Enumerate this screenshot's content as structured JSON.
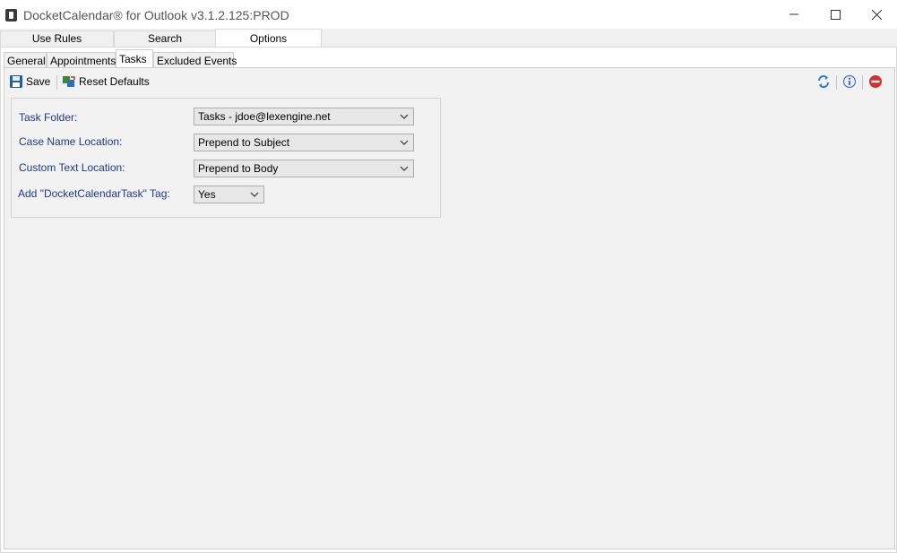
{
  "window": {
    "title": "DocketCalendar® for Outlook v3.1.2.125:PROD"
  },
  "main_tabs": [
    {
      "label": "Use Rules"
    },
    {
      "label": "Search"
    },
    {
      "label": "Options",
      "active": true
    }
  ],
  "sub_tabs": [
    {
      "label": "General"
    },
    {
      "label": "Appointments"
    },
    {
      "label": "Tasks",
      "active": true
    },
    {
      "label": "Excluded Events"
    }
  ],
  "toolbar": {
    "save_label": "Save",
    "reset_label": "Reset Defaults",
    "right_icons": [
      "refresh-icon",
      "info-icon",
      "stop-icon"
    ]
  },
  "form": {
    "task_folder": {
      "label": "Task Folder:",
      "value": "Tasks - jdoe@lexengine.net"
    },
    "case_name_location": {
      "label": "Case Name Location:",
      "value": "Prepend to Subject"
    },
    "custom_text_location": {
      "label": "Custom Text Location:",
      "value": "Prepend to Body"
    },
    "add_tag": {
      "label": "Add \"DocketCalendarTask\" Tag:",
      "value": "Yes"
    }
  },
  "colors": {
    "label_text": "#1e3a8a",
    "panel_bg": "#f2f2f2",
    "save_icon": "#1f5fa8",
    "stop_icon": "#d32f2f"
  }
}
